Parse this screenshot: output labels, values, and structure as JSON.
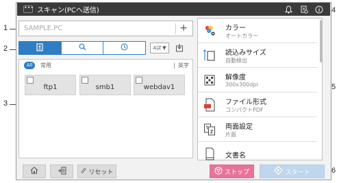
{
  "callouts": [
    "1",
    "2",
    "3",
    "4",
    "5",
    "6"
  ],
  "titlebar": {
    "menu_label": "•••",
    "title": "スキャン(PCへ送信)"
  },
  "address": {
    "placeholder": "SAMPLE.PC",
    "add_label": "+"
  },
  "sort_button_label": "A|Z",
  "list": {
    "all_label": "All",
    "category": "常用",
    "filter_label": "英字",
    "items": [
      "ftp1",
      "smb1",
      "webdav1"
    ]
  },
  "settings": [
    {
      "title": "カラー",
      "value": "オートカラー",
      "icon": "color-icon"
    },
    {
      "title": "読込みサイズ",
      "value": "自動検出",
      "icon": "scan-size-icon"
    },
    {
      "title": "解像度",
      "value": "300x300dpi",
      "icon": "resolution-icon"
    },
    {
      "title": "ファイル形式",
      "value": "コンパクトPDF",
      "icon": "pdf-file-icon"
    },
    {
      "title": "両面設定",
      "value": "片面",
      "icon": "duplex-icon"
    },
    {
      "title": "文書名",
      "value": "",
      "icon": "document-name-icon"
    }
  ],
  "bottom": {
    "reset_label": "リセット",
    "stop_label": "ストップ",
    "start_label": "スタート"
  },
  "colors": {
    "accent": "#2f7dc4",
    "stop": "#e8739a",
    "start": "#bfd6ec",
    "titlebar": "#3a3a3a"
  }
}
